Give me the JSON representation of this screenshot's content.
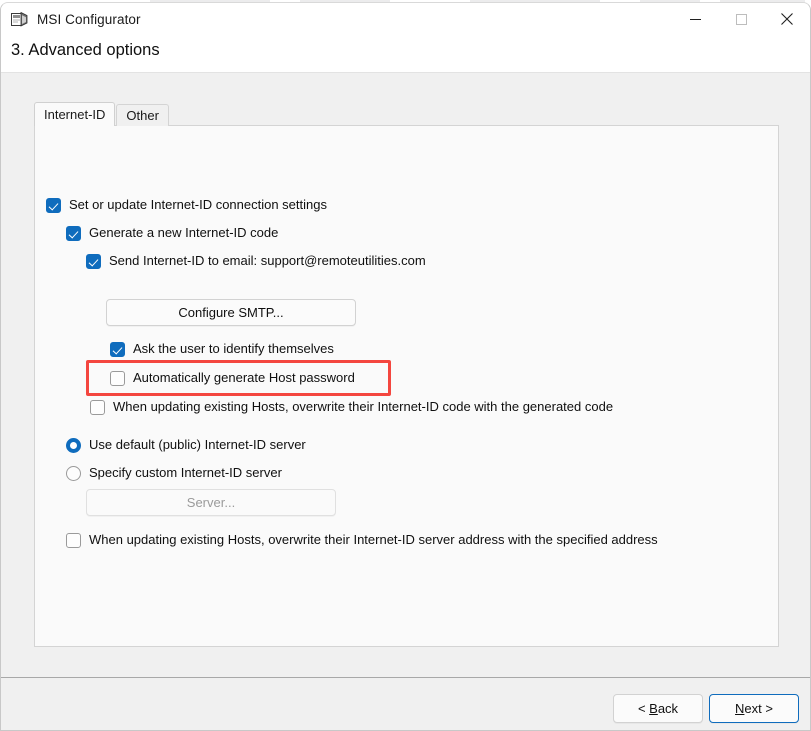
{
  "window": {
    "title": "MSI Configurator",
    "icon": "msi-package-icon",
    "minimize_label": "Minimize",
    "maximize_label": "Maximize",
    "close_label": "Close"
  },
  "header": {
    "step_title": "3. Advanced options"
  },
  "tabs": [
    {
      "label": "Internet-ID",
      "active": true
    },
    {
      "label": "Other",
      "active": false
    }
  ],
  "internet_id": {
    "set_update": {
      "label": "Set or update Internet-ID connection settings",
      "checked": true
    },
    "generate_code": {
      "label": "Generate a new Internet-ID code",
      "checked": true
    },
    "send_email": {
      "label": "Send Internet-ID to email: support@remoteutilities.com",
      "checked": true
    },
    "configure_smtp_button": "Configure SMTP...",
    "ask_user": {
      "label": "Ask the user to identify themselves",
      "checked": true
    },
    "auto_password": {
      "label": "Automatically generate Host password",
      "checked": false,
      "highlighted": true
    },
    "overwrite_code": {
      "label": "When updating existing Hosts, overwrite their Internet-ID code with the generated code",
      "checked": false
    },
    "server_mode": {
      "default_option": "Use default (public) Internet-ID server",
      "custom_option": "Specify custom Internet-ID server",
      "selected": "default"
    },
    "server_button": {
      "label": "Server...",
      "disabled": true
    },
    "overwrite_server": {
      "label": "When updating existing Hosts, overwrite their Internet-ID server address with the specified address",
      "checked": false
    }
  },
  "footer": {
    "back_prefix": "< ",
    "back_accel": "B",
    "back_suffix": "ack",
    "next_accel": "N",
    "next_suffix": "ext >"
  },
  "colors": {
    "accent": "#0f6cbd",
    "highlight": "#f4463f",
    "window_bg": "#f0f0f0",
    "panel_bg": "#fafafa"
  }
}
